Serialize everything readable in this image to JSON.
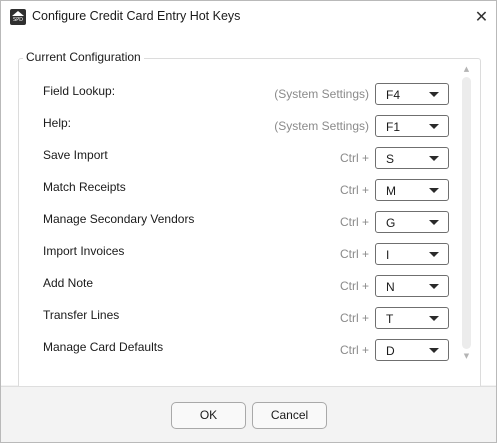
{
  "window": {
    "title": "Configure Credit Card Entry Hot Keys",
    "icon_text": "SPD"
  },
  "group": {
    "legend": "Current Configuration"
  },
  "rows": [
    {
      "label": "Field Lookup:",
      "prefix": "(System Settings)",
      "key": "F4"
    },
    {
      "label": "Help:",
      "prefix": "(System Settings)",
      "key": "F1"
    },
    {
      "label": "Save Import",
      "prefix": "Ctrl +",
      "key": "S"
    },
    {
      "label": "Match Receipts",
      "prefix": "Ctrl +",
      "key": "M"
    },
    {
      "label": "Manage Secondary Vendors",
      "prefix": "Ctrl +",
      "key": "G"
    },
    {
      "label": "Import Invoices",
      "prefix": "Ctrl +",
      "key": "I"
    },
    {
      "label": "Add Note",
      "prefix": "Ctrl +",
      "key": "N"
    },
    {
      "label": "Transfer Lines",
      "prefix": "Ctrl +",
      "key": "T"
    },
    {
      "label": "Manage Card Defaults",
      "prefix": "Ctrl +",
      "key": "D"
    }
  ],
  "buttons": {
    "ok": "OK",
    "cancel": "Cancel"
  },
  "icons": {
    "close": "close-icon",
    "dropdown": "chevron-down-icon",
    "app": "app-logo-icon"
  }
}
